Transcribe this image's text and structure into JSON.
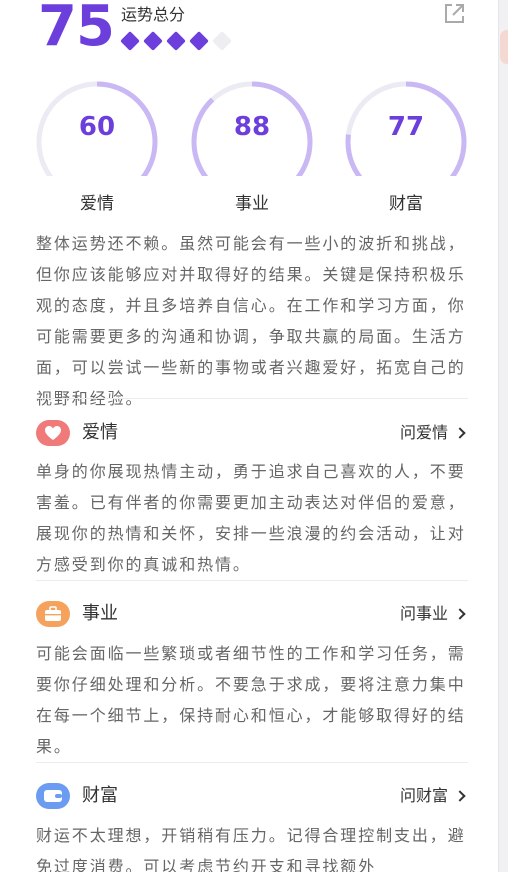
{
  "overall": {
    "score": "75",
    "label": "运势总分",
    "stars_filled": 4,
    "stars_total": 5
  },
  "rings": [
    {
      "value": "60",
      "label": "爱情",
      "percent": 60
    },
    {
      "value": "88",
      "label": "事业",
      "percent": 88
    },
    {
      "value": "77",
      "label": "财富",
      "percent": 77
    }
  ],
  "summary": "整体运势还不赖。虽然可能会有一些小的波折和挑战，但你应该能够应对并取得好的结果。关键是保持积极乐观的态度，并且多培养自信心。在工作和学习方面，你可能需要更多的沟通和协调，争取共赢的局面。生活方面，可以尝试一些新的事物或者兴趣爱好，拓宽自己的视野和经验。",
  "sections": {
    "love": {
      "title": "爱情",
      "link": "问爱情",
      "body": "单身的你展现热情主动，勇于追求自己喜欢的人，不要害羞。已有伴者的你需要更加主动表达对伴侣的爱意，展现你的热情和关怀，安排一些浪漫的约会活动，让对方感受到你的真诚和热情。",
      "icon": "heart-icon",
      "color": "#f07a7a"
    },
    "career": {
      "title": "事业",
      "link": "问事业",
      "body": "可能会面临一些繁琐或者细节性的工作和学习任务，需要你仔细处理和分析。不要急于求成，要将注意力集中在每一个细节上，保持耐心和恒心，才能够取得好的结果。",
      "icon": "briefcase-icon",
      "color": "#f5a35c"
    },
    "wealth": {
      "title": "财富",
      "link": "问财富",
      "body": "财运不太理想，开销稍有压力。记得合理控制支出，避免过度消费。可以考虑节约开支和寻找额外",
      "icon": "wallet-icon",
      "color": "#6b9cf2"
    }
  },
  "colors": {
    "accent": "#6c3fdc",
    "ring_track": "#ecebf4",
    "ring_fill": "#c9b8f3"
  }
}
